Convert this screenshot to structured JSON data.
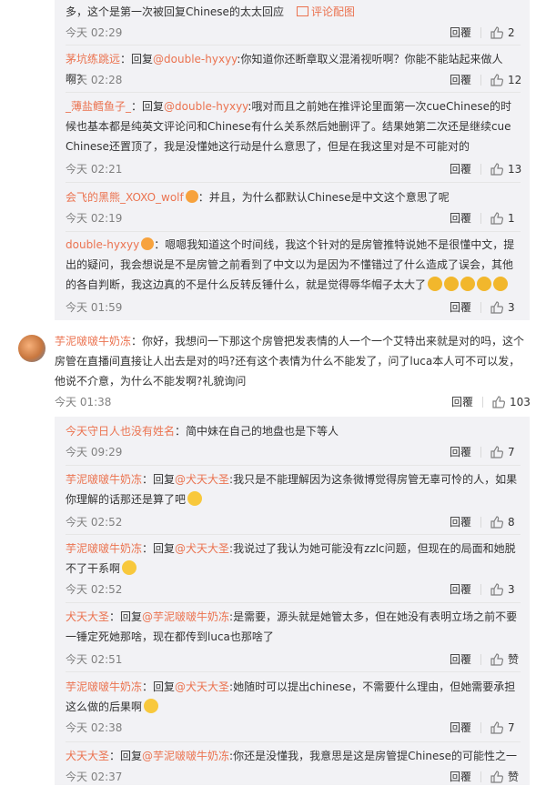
{
  "like_label": "回覆",
  "top_block": [
    {
      "text": "多，这个是第一次被回复Chinese的太太回应",
      "pic_link": "评论配图",
      "time": "今天 02:29",
      "likes": "2"
    },
    {
      "user": "茅坑练跳远",
      "reply_prefix": "：回复",
      "mention": "@double-hyxyy",
      "text": ":你知道你还断章取义混淆视听啊？你能不能站起来做人啊？",
      "time": "今天 02:28",
      "likes": "12"
    },
    {
      "user": "_薄盐鳕鱼子_",
      "reply_prefix": "：回复",
      "mention": "@double-hyxyy",
      "text": ":哦对而且之前她在推评论里面第一次cueChinese的时候也基本都是纯英文评论问和Chinese有什么关系然后她删评了。结果她第二次还是继续cue Chinese还置顶了，我是没懂她这行动是什么意思了，但是在我这里对是不可能对的",
      "time": "今天 02:21",
      "likes": "13"
    },
    {
      "user": "会飞的黑熊_XOXO_wolf",
      "text": "：并且，为什么都默认Chinese是中文这个意思了呢",
      "time": "今天 02:19",
      "likes": "1"
    },
    {
      "user": "double-hyxyy",
      "text": "：嗯嗯我知道这个时间线，我这个针对的是房管推特说她不是很懂中文，提出的疑问，我会想说是不是房管之前看到了中文以为是因为不懂错过了什么造成了误会，其他的各自判断，我这边真的不是什么反转反锤什么，就是觉得辱华帽子太大了",
      "time": "今天 01:59",
      "likes": "3"
    }
  ],
  "main_comment": {
    "user": "芋泥啵啵牛奶冻",
    "text": "：你好，我想问一下那这个房管把发表情的人一个一个艾特出来就是对的吗，这个房管在直播间直接让人出去是对的吗?还有这个表情为什么不能发了，问了luca本人可不可以发，他说不介意，为什么不能发啊?礼貌询问",
    "time": "今天 01:38",
    "likes": "103"
  },
  "sub_replies": [
    {
      "user": "今天守日人也没有姓名",
      "text": "：简中妹在自己的地盘也是下等人",
      "time": "今天 09:29",
      "likes": "7"
    },
    {
      "user": "芋泥啵啵牛奶冻",
      "reply_prefix": "：回复",
      "mention": "@犬天大圣",
      "text": ":我只是不能理解因为这条微博觉得房管无辜可怜的人，如果你理解的话那还是算了吧",
      "time": "今天 02:52",
      "likes": "8"
    },
    {
      "user": "芋泥啵啵牛奶冻",
      "reply_prefix": "：回复",
      "mention": "@犬天大圣",
      "text": ":我说过了我认为她可能没有zzlc问题，但现在的局面和她脱不了干系啊",
      "time": "今天 02:52",
      "likes": "3"
    },
    {
      "user": "犬天大圣",
      "reply_prefix": "：回复",
      "mention": "@芋泥啵啵牛奶冻",
      "text": ":是需要，源头就是她管太多，但在她没有表明立场之前不要一锤定死她那啥，现在都传到luca也那啥了",
      "time": "今天 02:51",
      "likes": "赞"
    },
    {
      "user": "芋泥啵啵牛奶冻",
      "reply_prefix": "：回复",
      "mention": "@犬天大圣",
      "text": ":她随时可以提出chinese，不需要什么理由，但她需要承担这么做的后果啊",
      "time": "今天 02:38",
      "likes": "7"
    },
    {
      "user": "犬天大圣",
      "reply_prefix": "：回复",
      "mention": "@芋泥啵啵牛奶冻",
      "text": ":你还是没懂我，我意思是这是房管提Chinese的可能性之一",
      "time": "今天 02:37",
      "likes": "赞"
    }
  ]
}
